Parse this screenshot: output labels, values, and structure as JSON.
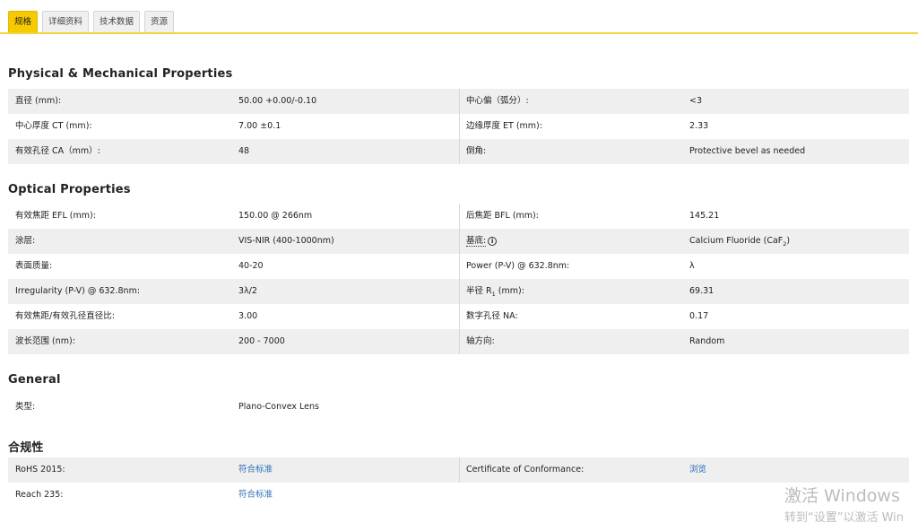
{
  "tabs": [
    {
      "label": "规格",
      "active": true
    },
    {
      "label": "详细资料",
      "active": false
    },
    {
      "label": "技术数据",
      "active": false
    },
    {
      "label": "资源",
      "active": false
    }
  ],
  "sections": {
    "physical": {
      "title": "Physical & Mechanical Properties",
      "rows": [
        {
          "k1": "直径 (mm):",
          "v1": "50.00 +0.00/-0.10",
          "k2": "中心偏（弧分）:",
          "v2": "<3"
        },
        {
          "k1": "中心厚度 CT (mm):",
          "v1": "7.00 ±0.1",
          "k2": "边缘厚度 ET (mm):",
          "v2": "2.33"
        },
        {
          "k1": "有效孔径 CA（mm）:",
          "v1": "48",
          "k2": "倒角:",
          "v2": "Protective bevel as needed"
        }
      ]
    },
    "optical": {
      "title": "Optical Properties",
      "rows": [
        {
          "k1": "有效焦距 EFL (mm):",
          "v1": "150.00 @ 266nm",
          "k2": "后焦距 BFL (mm):",
          "v2": "145.21"
        },
        {
          "k1": "涂层:",
          "v1": "VIS-NIR (400-1000nm)",
          "k2": "基底:",
          "v2": "Calcium Fluoride (CaF",
          "v2_sub": "2",
          "v2_end": ")"
        },
        {
          "k1": "表面质量:",
          "v1": "40-20",
          "k2": "Power (P-V) @ 632.8nm:",
          "v2": "λ"
        },
        {
          "k1": "Irregularity (P-V) @ 632.8nm:",
          "v1": "3λ/2",
          "k2": "半径 R",
          "k2_sub": "1",
          "k2_end": " (mm):",
          "v2": "69.31"
        },
        {
          "k1": "有效焦距/有效孔径直径比:",
          "v1": "3.00",
          "k2": "数字孔径 NA:",
          "v2": "0.17"
        },
        {
          "k1": "波长范围 (nm):",
          "v1": "200 - 7000",
          "k2": "轴方向:",
          "v2": "Random"
        }
      ]
    },
    "general": {
      "title": "General",
      "rows": [
        {
          "k1": "类型:",
          "v1": "Plano-Convex Lens"
        }
      ]
    },
    "compliance": {
      "title": "合规性",
      "rows": [
        {
          "k1": "RoHS 2015:",
          "v1": "符合标准",
          "k2": "Certificate of Conformance:",
          "v2": "浏览"
        },
        {
          "k1": "Reach 235:",
          "v1": "符合标准"
        }
      ]
    }
  },
  "info_icon_glyph": "i",
  "watermark": {
    "line1": "激活 Windows",
    "line2": "转到“设置”以激活 Win"
  },
  "colors": {
    "accent": "#f7c900",
    "link": "#2a6db5",
    "row_shade": "#efefef"
  }
}
